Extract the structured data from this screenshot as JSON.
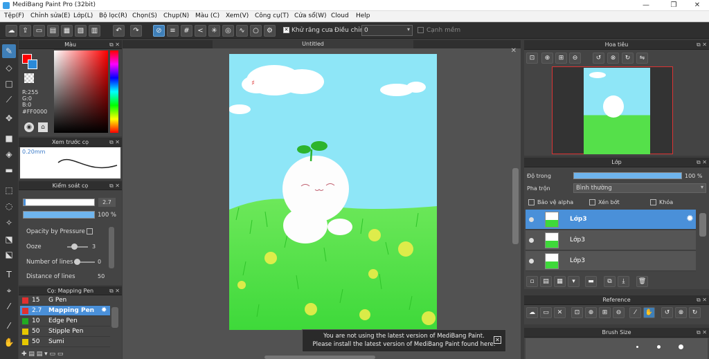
{
  "window": {
    "title": "MediBang Paint Pro (32bit)"
  },
  "menu": [
    "Tệp(F)",
    "Chỉnh sửa(E)",
    "Lớp(L)",
    "Bộ lọc(R)",
    "Chọn(S)",
    "Chụp(N)",
    "Màu (C)",
    "Xem(V)",
    "Công cụ(T)",
    "Cửa sổ(W)",
    "Cloud",
    "Help"
  ],
  "toolbar": {
    "antialias_label": "Khử răng cưa",
    "adjust_label": "Điều chỉnh",
    "adjust_value": "0",
    "sharp_label": "Cạnh mềm"
  },
  "color_panel": {
    "title": "Màu",
    "r": "R:255",
    "g": "G:0",
    "b": "B:0",
    "hex": "#FF0000",
    "primary": "#ff0000",
    "secondary": "#2a8ad8"
  },
  "preview_panel": {
    "title": "Xem trước cọ",
    "size": "0.20mm"
  },
  "brush_ctrl": {
    "title": "Kiểm soát cọ",
    "size_value": "2.7",
    "opacity_value": "100 %",
    "opacity_pressure": "Opacity by Pressure",
    "ooze_label": "Ooze",
    "ooze_value": "3",
    "lines_label": "Number of lines",
    "lines_value": "0",
    "dist_label": "Distance of lines",
    "dist_value": "50"
  },
  "brush_list": {
    "title": "Cọ: Mapping Pen",
    "items": [
      {
        "size": "15",
        "name": "G Pen",
        "color": "#e03030"
      },
      {
        "size": "2.7",
        "name": "Mapping Pen",
        "color": "#e03030"
      },
      {
        "size": "10",
        "name": "Edge Pen",
        "color": "#22aa22"
      },
      {
        "size": "50",
        "name": "Stipple Pen",
        "color": "#e6c800"
      },
      {
        "size": "50",
        "name": "Sumi",
        "color": "#e6c800"
      }
    ]
  },
  "canvas": {
    "tab": "Untitled"
  },
  "notice": {
    "line1": "You are not using the latest version of MediBang Paint.",
    "line2": "Please install the latest version of MediBang Paint found here."
  },
  "navigator": {
    "title": "Hoa tiêu"
  },
  "layers": {
    "title": "Lớp",
    "opacity_label": "Độ trong",
    "opacity_value": "100 %",
    "blend_label": "Pha trộn",
    "blend_value": "Bình thường",
    "protect_alpha": "Bảo vệ alpha",
    "clipping": "Xén bớt",
    "lock": "Khóa",
    "items": [
      "Lớp3",
      "Lớp3",
      "Lớp3"
    ]
  },
  "reference": {
    "title": "Reference"
  },
  "brush_size": {
    "title": "Brush Size"
  }
}
